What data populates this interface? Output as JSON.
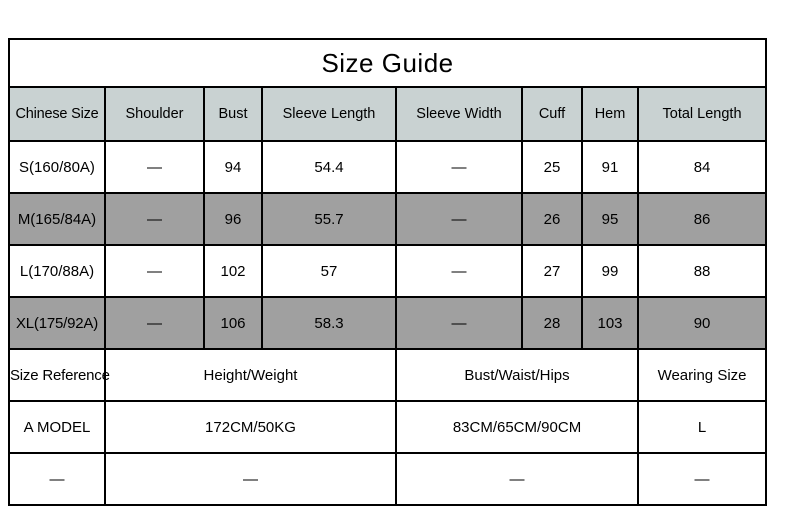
{
  "table": {
    "title": "Size Guide",
    "dash": "—",
    "measurement_columns": [
      "Chinese Size",
      "Shoulder",
      "Bust",
      "Sleeve Length",
      "Sleeve Width",
      "Cuff",
      "Hem",
      "Total Length"
    ],
    "measurement_rows": [
      {
        "shade": "light",
        "cells": [
          "S(160/80A)",
          "—",
          "94",
          "54.4",
          "—",
          "25",
          "91",
          "84"
        ]
      },
      {
        "shade": "dark",
        "cells": [
          "M(165/84A)",
          "—",
          "96",
          "55.7",
          "—",
          "26",
          "95",
          "86"
        ]
      },
      {
        "shade": "light",
        "cells": [
          "L(170/88A)",
          "—",
          "102",
          "57",
          "—",
          "27",
          "99",
          "88"
        ]
      },
      {
        "shade": "dark",
        "cells": [
          "XL(175/92A)",
          "—",
          "106",
          "58.3",
          "—",
          "28",
          "103",
          "90"
        ]
      }
    ],
    "reference_header": [
      "Size Reference",
      "Height/Weight",
      "Bust/Waist/Hips",
      "Wearing Size"
    ],
    "reference_rows": [
      {
        "cells": [
          "A MODEL",
          "172CM/50KG",
          "83CM/65CM/90CM",
          "L"
        ]
      },
      {
        "cells": [
          "—",
          "—",
          "—",
          "—"
        ]
      }
    ]
  },
  "colors": {
    "header_background": "#c9d2d2",
    "row_shade_dark": "#a0a0a0",
    "row_shade_light": "#ffffff",
    "border": "#000000",
    "text": "#000000",
    "page_background": "#ffffff"
  }
}
